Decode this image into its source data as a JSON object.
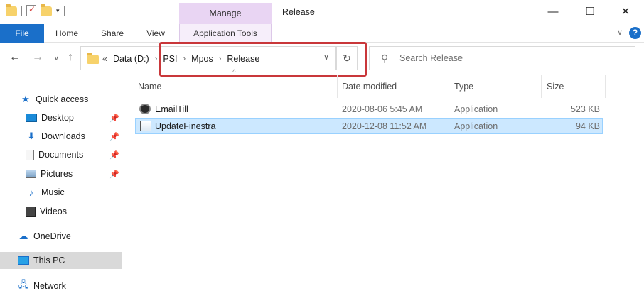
{
  "window": {
    "title": "Release",
    "minimize_glyph": "—",
    "maximize_glyph": "☐",
    "close_glyph": "✕"
  },
  "qat": {
    "dropdown_glyph": "▾"
  },
  "context_tab": {
    "group_label": "Manage",
    "tab_label": "Application Tools"
  },
  "ribbon": {
    "tabs": [
      "File",
      "Home",
      "Share",
      "View"
    ],
    "collapse_glyph": "∨",
    "help_glyph": "?"
  },
  "nav": {
    "back_glyph": "←",
    "forward_glyph": "→",
    "recent_glyph": "∨",
    "up_glyph": "↑",
    "refresh_glyph": "↻"
  },
  "address": {
    "overflow": "«",
    "crumbs": [
      "Data (D:)",
      "PSI",
      "Mpos",
      "Release"
    ],
    "separator": "›",
    "dropdown_glyph": "∨"
  },
  "search": {
    "placeholder": "Search Release",
    "icon_glyph": "⚲"
  },
  "sidebar": {
    "pin_glyph": "📌",
    "items": [
      {
        "label": "Quick access",
        "icon": "star-icon"
      },
      {
        "label": "Desktop",
        "icon": "desktop-icon",
        "pinned": true
      },
      {
        "label": "Downloads",
        "icon": "download-icon",
        "pinned": true
      },
      {
        "label": "Documents",
        "icon": "document-icon",
        "pinned": true
      },
      {
        "label": "Pictures",
        "icon": "pictures-icon",
        "pinned": true
      },
      {
        "label": "Music",
        "icon": "music-icon"
      },
      {
        "label": "Videos",
        "icon": "video-icon"
      },
      {
        "label": "OneDrive",
        "icon": "cloud-icon"
      },
      {
        "label": "This PC",
        "icon": "computer-icon",
        "selected": true
      },
      {
        "label": "Network",
        "icon": "network-icon"
      }
    ]
  },
  "filelist": {
    "sort_indicator": "^",
    "columns": [
      "Name",
      "Date modified",
      "Type",
      "Size"
    ],
    "rows": [
      {
        "name": "EmailTill",
        "date": "2020-08-06 5:45 AM",
        "type": "Application",
        "size": "523 KB",
        "icon": "gear-app-icon"
      },
      {
        "name": "UpdateFinestra",
        "date": "2020-12-08 11:52 AM",
        "type": "Application",
        "size": "94 KB",
        "icon": "app-window-icon",
        "selected": true
      }
    ]
  },
  "colors": {
    "accent": "#1a6fc9",
    "manage_tab": "#e9d5f3",
    "highlight_box": "#c9373a",
    "selection": "#cce8ff"
  }
}
